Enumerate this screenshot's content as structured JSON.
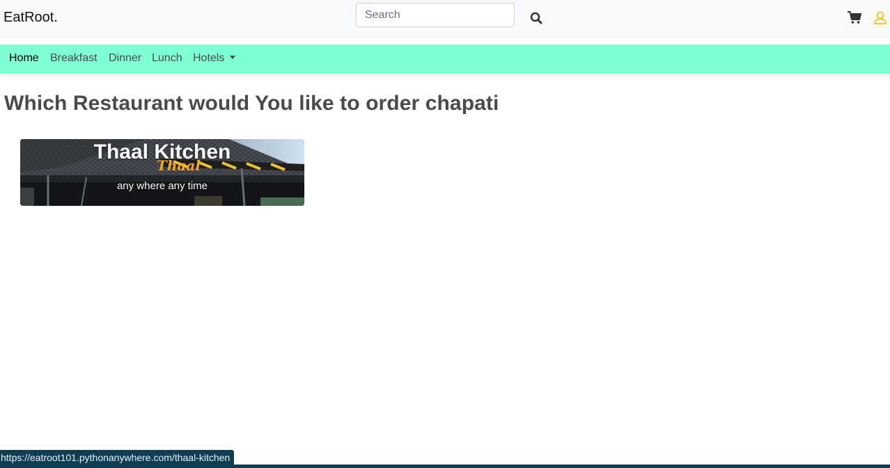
{
  "header": {
    "brand": "EatRoot.",
    "search_placeholder": "Search"
  },
  "nav": {
    "items": [
      {
        "label": "Home"
      },
      {
        "label": "Breakfast"
      },
      {
        "label": "Dinner"
      },
      {
        "label": "Lunch"
      },
      {
        "label": "Hotels"
      }
    ]
  },
  "main": {
    "heading_prefix": "Which Restaurant would You like to order ",
    "heading_item": "chapati",
    "restaurants": [
      {
        "name": "Thaal Kitchen",
        "tagline": "any where any time",
        "logo_text": "Thaal"
      }
    ]
  },
  "status_bar": {
    "url": "https://eatroot101.pythonanywhere.com/thaal-kitchen"
  },
  "colors": {
    "nav_bg": "#7fffd4",
    "user_icon": "#f0c419",
    "status_bg": "#0f3d53"
  },
  "icons": [
    "search-icon",
    "cart-icon",
    "user-icon",
    "chevron-down-icon"
  ]
}
